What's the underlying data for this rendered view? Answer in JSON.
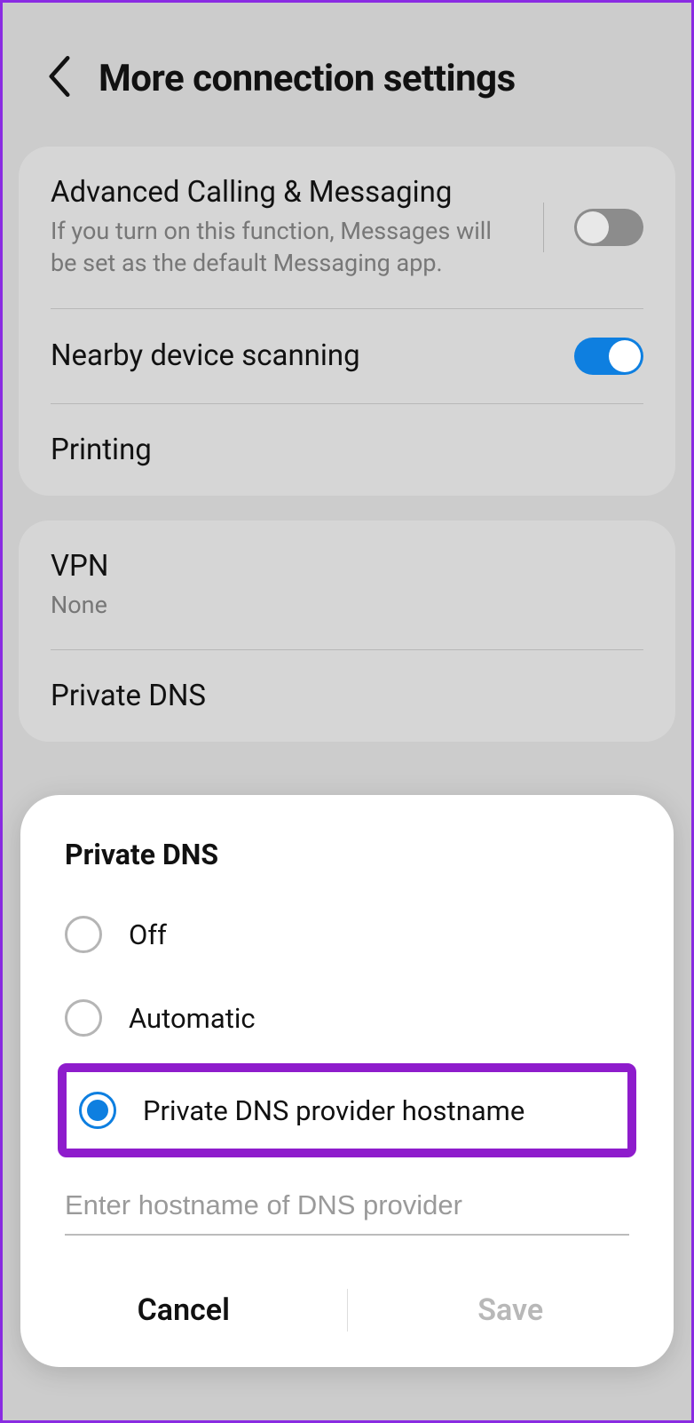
{
  "header": {
    "title": "More connection settings"
  },
  "section1": {
    "advCalling": {
      "title": "Advanced Calling & Messaging",
      "sub": "If you turn on this function, Messages will be set as the default Messaging app."
    },
    "nearby": {
      "title": "Nearby device scanning"
    },
    "printing": {
      "title": "Printing"
    }
  },
  "section2": {
    "vpn": {
      "title": "VPN",
      "sub": "None"
    },
    "privateDns": {
      "title": "Private DNS"
    }
  },
  "dialog": {
    "title": "Private DNS",
    "options": {
      "off": "Off",
      "auto": "Automatic",
      "hostname": "Private DNS provider hostname"
    },
    "placeholder": "Enter hostname of DNS provider",
    "cancel": "Cancel",
    "save": "Save"
  }
}
